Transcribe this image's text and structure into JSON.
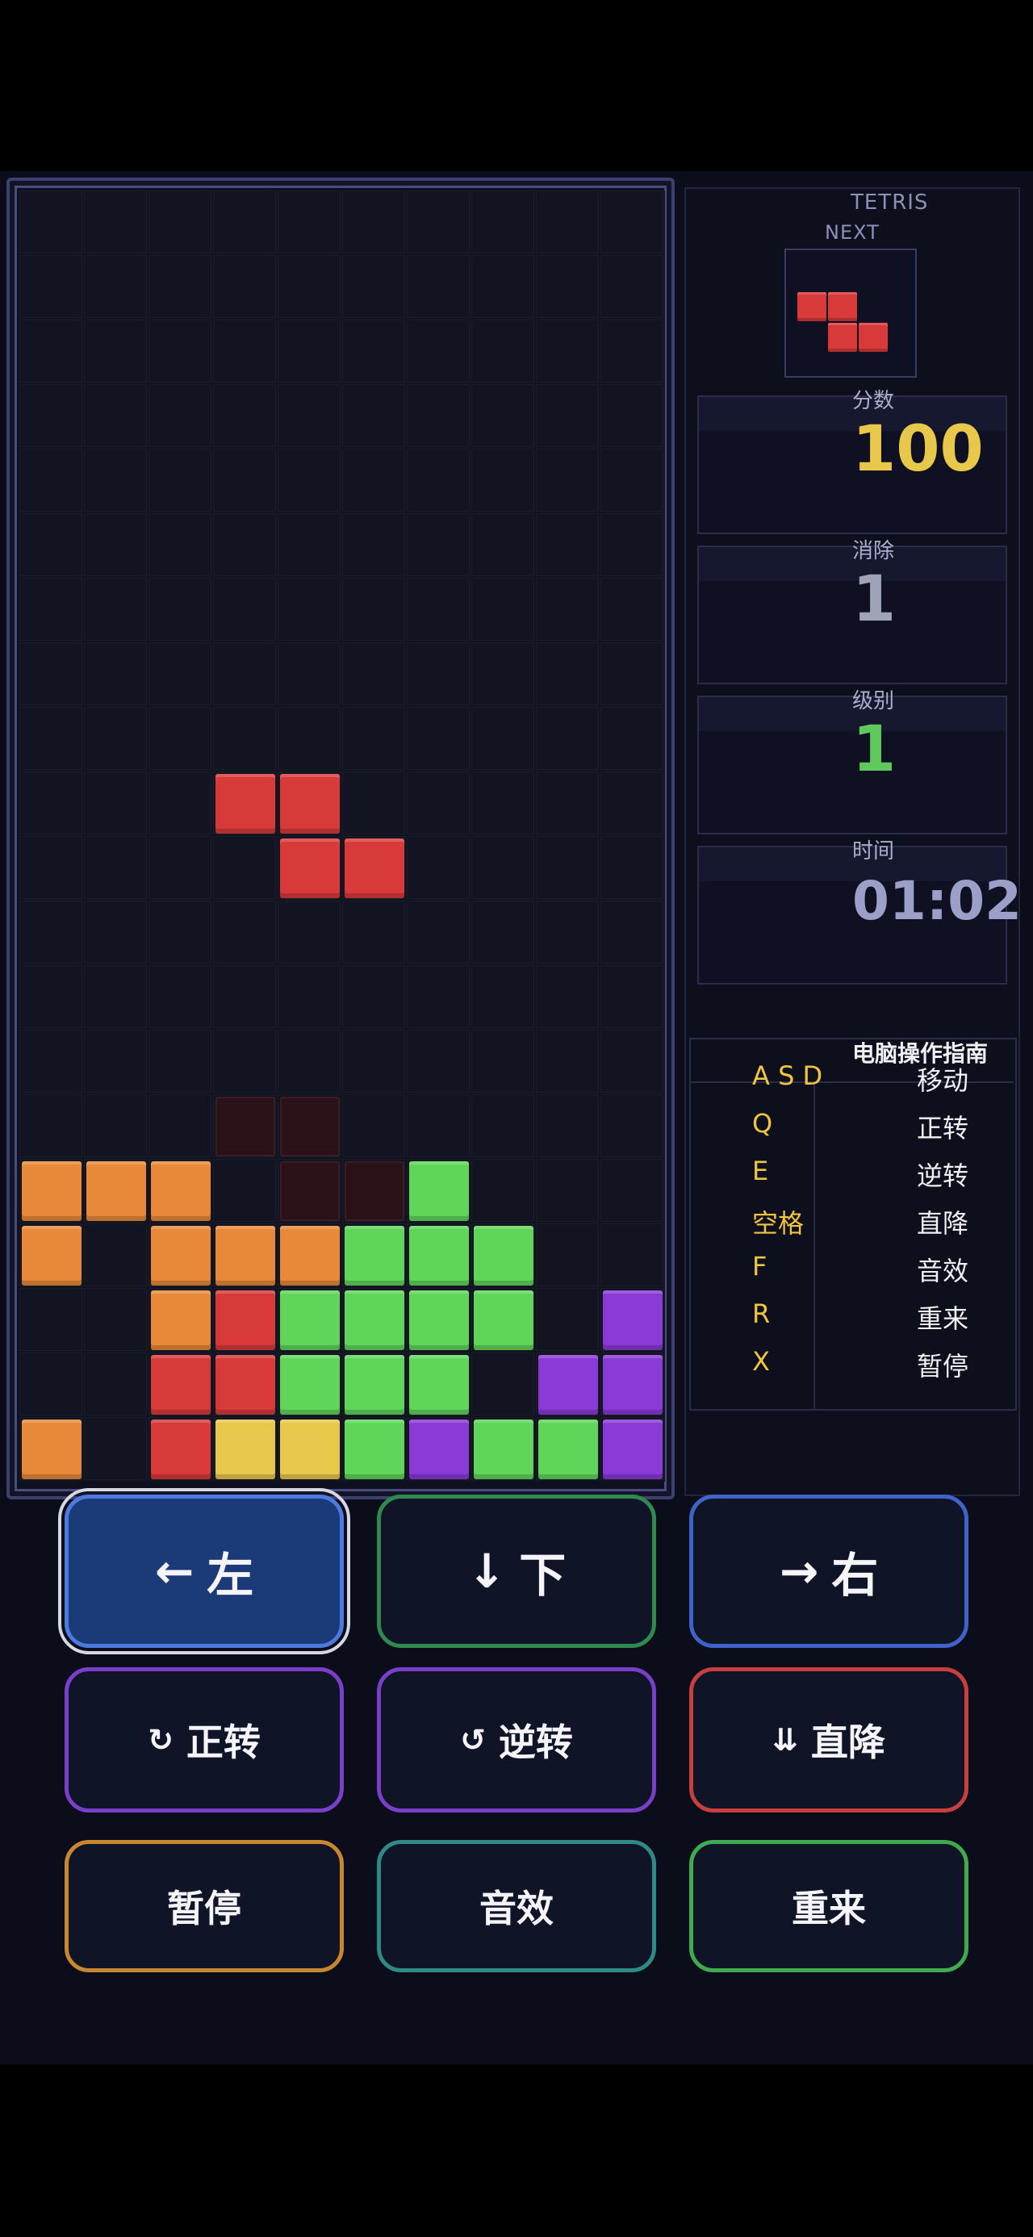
{
  "app": {
    "title": "TETRIS"
  },
  "next": {
    "label": "NEXT",
    "piece": "Z",
    "color": "#d83a3a"
  },
  "stats": {
    "score": {
      "label": "分数",
      "value": "100",
      "color": "#e8c84a"
    },
    "lines": {
      "label": "消除",
      "value": "1",
      "color": "#9ea3b8"
    },
    "level": {
      "label": "级别",
      "value": "1",
      "color": "#5fc95c"
    },
    "time": {
      "label": "时间",
      "value": "01:02",
      "color": "#9ca0c8"
    }
  },
  "guide": {
    "title": "电脑操作指南",
    "rows": [
      {
        "key": "A S D",
        "action": "移动"
      },
      {
        "key": "Q",
        "action": "正转"
      },
      {
        "key": "E",
        "action": "逆转"
      },
      {
        "key": "空格",
        "action": "直降"
      },
      {
        "key": "F",
        "action": "音效"
      },
      {
        "key": "R",
        "action": "重来"
      },
      {
        "key": "X",
        "action": "暂停"
      }
    ]
  },
  "board": {
    "cols": 10,
    "rows": 20,
    "colors": {
      "O": "#e8893a",
      "R": "#d83a3a",
      "G": "#5fd65a",
      "P": "#8a3ad6",
      "Y": "#e8c84a"
    },
    "active_piece": {
      "type": "Z",
      "color_key": "R",
      "cells": [
        [
          9,
          3
        ],
        [
          9,
          4
        ],
        [
          10,
          4
        ],
        [
          10,
          5
        ]
      ]
    },
    "ghost_cells": [
      [
        14,
        3
      ],
      [
        14,
        4
      ],
      [
        15,
        4
      ],
      [
        15,
        5
      ]
    ],
    "locked": [
      [
        15,
        0,
        "O"
      ],
      [
        15,
        1,
        "O"
      ],
      [
        15,
        2,
        "O"
      ],
      [
        15,
        6,
        "G"
      ],
      [
        16,
        0,
        "O"
      ],
      [
        16,
        2,
        "O"
      ],
      [
        16,
        3,
        "O"
      ],
      [
        16,
        4,
        "O"
      ],
      [
        16,
        5,
        "G"
      ],
      [
        16,
        6,
        "G"
      ],
      [
        16,
        7,
        "G"
      ],
      [
        17,
        2,
        "O"
      ],
      [
        17,
        3,
        "R"
      ],
      [
        17,
        4,
        "G"
      ],
      [
        17,
        5,
        "G"
      ],
      [
        17,
        6,
        "G"
      ],
      [
        17,
        7,
        "G"
      ],
      [
        17,
        9,
        "P"
      ],
      [
        18,
        2,
        "R"
      ],
      [
        18,
        3,
        "R"
      ],
      [
        18,
        4,
        "G"
      ],
      [
        18,
        5,
        "G"
      ],
      [
        18,
        6,
        "G"
      ],
      [
        18,
        8,
        "P"
      ],
      [
        18,
        9,
        "P"
      ],
      [
        19,
        0,
        "O"
      ],
      [
        19,
        2,
        "R"
      ],
      [
        19,
        3,
        "Y"
      ],
      [
        19,
        4,
        "Y"
      ],
      [
        19,
        5,
        "G"
      ],
      [
        19,
        6,
        "P"
      ],
      [
        19,
        7,
        "G"
      ],
      [
        19,
        8,
        "G"
      ],
      [
        19,
        9,
        "P"
      ]
    ]
  },
  "controls": {
    "left": {
      "icon": "←",
      "label": "左",
      "border": "#3f63c8"
    },
    "down": {
      "icon": "↓",
      "label": "下",
      "border": "#2f8a4f"
    },
    "right": {
      "icon": "→",
      "label": "右",
      "border": "#3f63c8"
    },
    "rotate_cw": {
      "icon": "↻",
      "label": "正转",
      "border": "#7a3fc8"
    },
    "rotate_ccw": {
      "icon": "↺",
      "label": "逆转",
      "border": "#7a3fc8"
    },
    "hard_drop": {
      "icon": "⇊",
      "label": "直降",
      "border": "#c83f3f"
    },
    "pause": {
      "label": "暂停",
      "border": "#c8862f"
    },
    "sound": {
      "label": "音效",
      "border": "#2f8a86"
    },
    "restart": {
      "label": "重来",
      "border": "#3faa4f"
    }
  }
}
